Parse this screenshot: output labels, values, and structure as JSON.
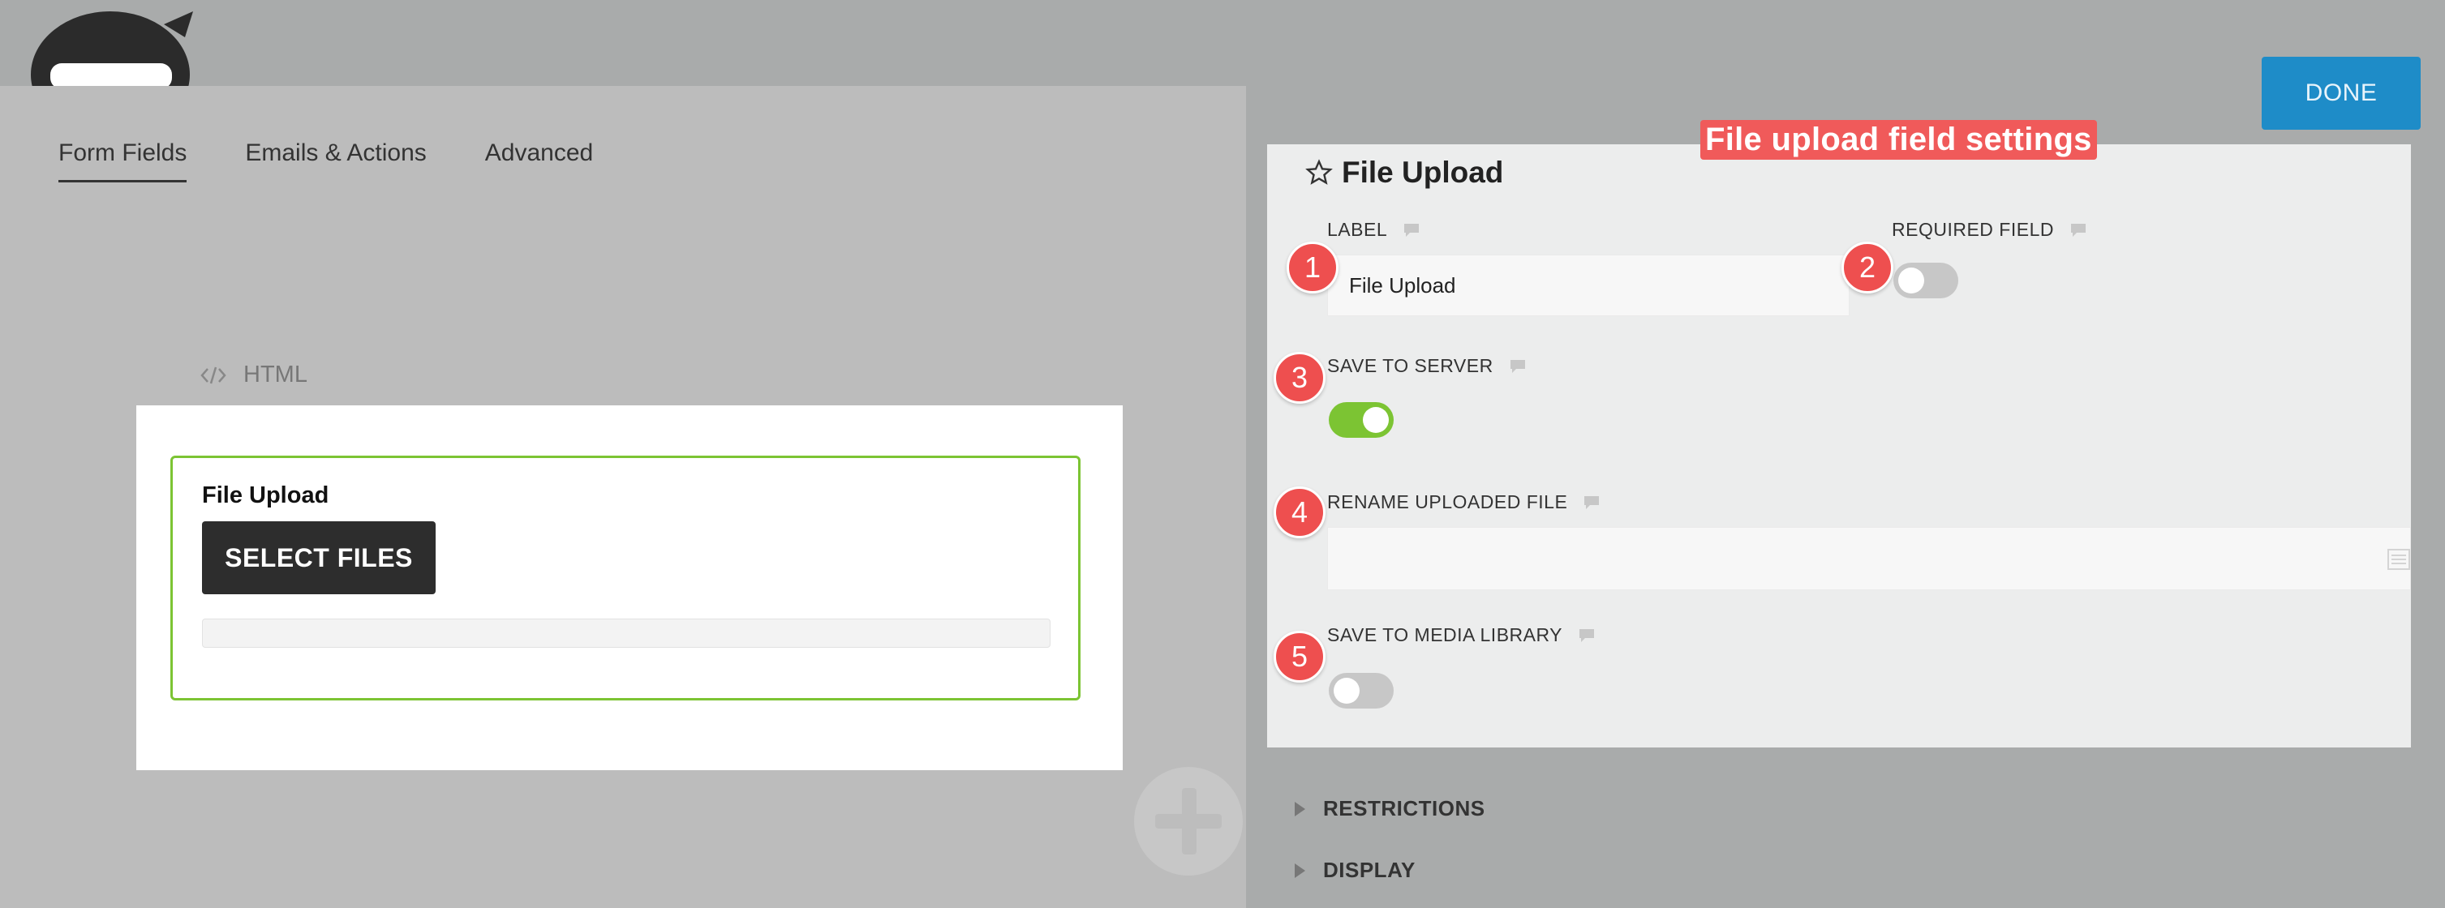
{
  "tabs": [
    {
      "label": "Form Fields",
      "active": true
    },
    {
      "label": "Emails & Actions",
      "active": false
    },
    {
      "label": "Advanced",
      "active": false
    }
  ],
  "done_label": "DONE",
  "builder": {
    "html_label": "HTML",
    "field_title": "File Upload",
    "select_files_label": "SELECT FILES"
  },
  "annotation": "File upload field settings",
  "panel": {
    "title": "File Upload",
    "label_heading": "LABEL",
    "label_value": "File Upload",
    "required_heading": "REQUIRED FIELD",
    "required_on": false,
    "save_server_heading": "SAVE TO SERVER",
    "save_server_on": true,
    "rename_heading": "RENAME UPLOADED FILE",
    "rename_value": "",
    "media_library_heading": "SAVE TO MEDIA LIBRARY",
    "media_library_on": false
  },
  "badges": [
    "1",
    "2",
    "3",
    "4",
    "5"
  ],
  "sections": [
    "RESTRICTIONS",
    "DISPLAY"
  ],
  "colors": {
    "accent_green": "#7cc433",
    "done_blue": "#1e8cc8",
    "badge_red": "#ee4f4f"
  }
}
